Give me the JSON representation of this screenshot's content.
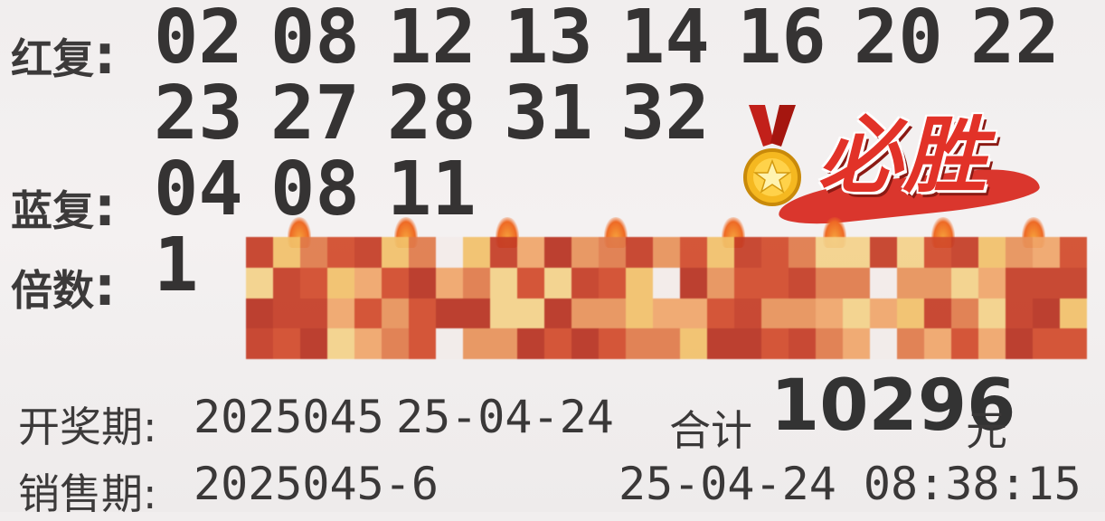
{
  "ticket": {
    "red_label": "红复",
    "red_row1": [
      "02",
      "08",
      "12",
      "13",
      "14",
      "16",
      "20",
      "22"
    ],
    "red_row2": [
      "23",
      "27",
      "28",
      "31",
      "32"
    ],
    "blue_label": "蓝复",
    "blue_numbers": [
      "04",
      "08",
      "11"
    ],
    "multiple_label": "倍数",
    "multiple_value": "1",
    "colon": ":",
    "draw_label": "开奖期",
    "draw_issue": "2025045",
    "draw_date": "25-04-24",
    "total_label": "合计",
    "total_value": "10296",
    "total_unit": "元",
    "sale_label": "销售期",
    "sale_issue": "2025045-6",
    "sale_datetime": "25-04-24 08:38:15"
  },
  "sticker": {
    "text": "必胜",
    "medal_icon": "gold-star-medal-icon",
    "accent": "#e23228"
  },
  "overlay": {
    "icon": "pixelated-censor-mosaic",
    "colors": [
      "#e07a4a",
      "#d24a2a",
      "#f0a66a",
      "#c53c25",
      "#f2c16a",
      "#e8925a",
      "#b83220",
      "#f4d28a"
    ]
  }
}
